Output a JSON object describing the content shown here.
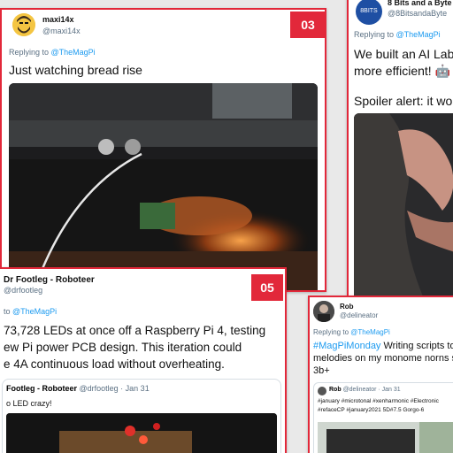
{
  "card_03": {
    "number": "03",
    "name": "maxi14x",
    "handle": "@maxi14x",
    "reply_prefix": "Replying to ",
    "reply_to": "@TheMagPi",
    "text": "Just watching bread rise"
  },
  "card_top_right": {
    "avatar_text": "8BITS",
    "name": "8 Bits and a Byte",
    "handle": "@8BitsandaByte",
    "reply_prefix": "Replying to ",
    "reply_to": "@TheMagPi",
    "text_line1": "We built an AI Lab",
    "text_line2": "more efficient! 🤖",
    "text_line3": "Spoiler alert: it wo"
  },
  "card_05": {
    "number": "05",
    "name": "Dr Footleg - Roboteer",
    "handle": "@drfootleg",
    "reply_prefix": "to ",
    "reply_to": "@TheMagPi",
    "text_line1": "73,728 LEDs at once off a Raspberry Pi 4, testing",
    "text_line2": "ew Pi power PCB design. This iteration could",
    "text_line3": "e 4A continuous load without overheating.",
    "quote": {
      "name": "Footleg - Roboteer",
      "handle_date": "@drfootleg · Jan 31",
      "text": "o LED crazy!"
    }
  },
  "card_rob": {
    "name": "Rob",
    "handle": "@delineator",
    "reply_prefix": "Replying to ",
    "reply_to": "@TheMagPi",
    "hashtag": "#MagPiMonday",
    "text_line1_rest": " Writing scripts to",
    "text_line2": "melodies on my monome norns s",
    "text_line3": "3b+",
    "quote": {
      "name": "Rob",
      "handle_date": "@delineator · Jan 31",
      "line1": "#january #microtonal #xenharmonic #Electronic",
      "line2": "#refaceCP #january2021 5D#7.5 Gorgo-6"
    }
  },
  "colors": {
    "accent": "#e2283a",
    "link": "#1d9bf0",
    "muted": "#5b7083"
  }
}
